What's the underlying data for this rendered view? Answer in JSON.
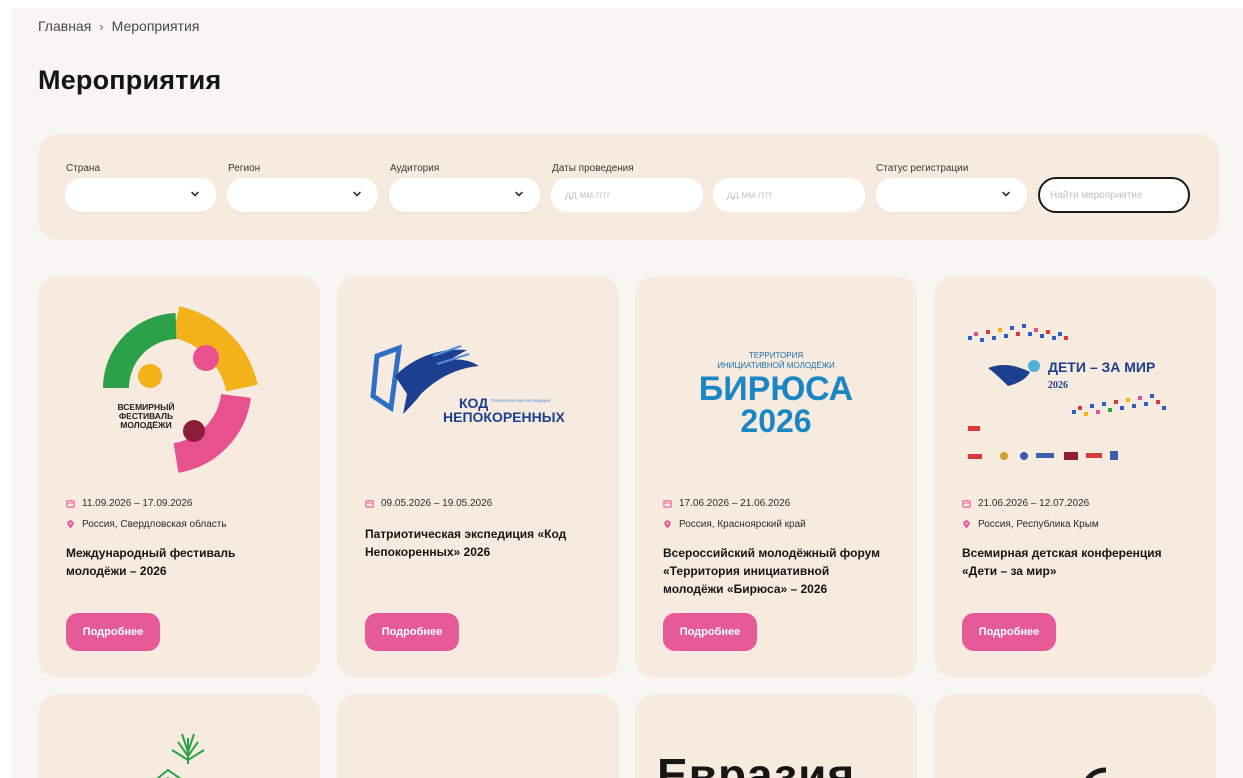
{
  "breadcrumb": {
    "home": "Главная",
    "separator": "›",
    "current": "Мероприятия"
  },
  "page_title": "Мероприятия",
  "filters": {
    "country_label": "Страна",
    "region_label": "Регион",
    "audience_label": "Аудитория",
    "dates_label": "Даты проведения",
    "date_from_placeholder": "дд.мм.гггг",
    "date_to_placeholder": "дд.мм.гггг",
    "status_label": "Статус регистрации",
    "search_placeholder": "Найти мероприятие"
  },
  "colors": {
    "accent": "#e75a9a",
    "card_bg": "#f7ebdf",
    "page_bg": "#f8f6f3"
  },
  "cards": [
    {
      "dates": "11.09.2026 – 17.09.2026",
      "location": "Россия, Свердловская область",
      "title": "Международный фестиваль молодёжи – 2026",
      "button": "Подробнее",
      "logo_text": [
        "ВСЕМИРНЫЙ",
        "ФЕСТИВАЛЬ",
        "МОЛОДЁЖИ"
      ]
    },
    {
      "dates": "09.05.2026 – 19.05.2026",
      "location": "",
      "title": "Патриотическая экспедиция «Код Непокоренных» 2026",
      "button": "Подробнее",
      "logo_text": [
        "КОД",
        "НЕПОКОРЕННЫХ",
        "Патриотическая экспедиция"
      ]
    },
    {
      "dates": "17.06.2026 – 21.06.2026",
      "location": "Россия, Красноярский край",
      "title": "Всероссийский молодёжный форум «Территория инициативной молодёжи «Бирюса» – 2026",
      "button": "Подробнее",
      "logo_text": [
        "ТЕРРИТОРИЯ",
        "ИНИЦИАТИВНОЙ МОЛОДЁЖИ",
        "БИРЮСА",
        "2026"
      ]
    },
    {
      "dates": "21.06.2026 – 12.07.2026",
      "location": "Россия, Республика Крым",
      "title": "Всемирная детская конференция «Дети – за мир»",
      "button": "Подробнее",
      "logo_text": [
        "ДЕТИ – ЗА МИР",
        "2026"
      ]
    }
  ],
  "bottom_partial": {
    "card3_text": "Евразия"
  }
}
